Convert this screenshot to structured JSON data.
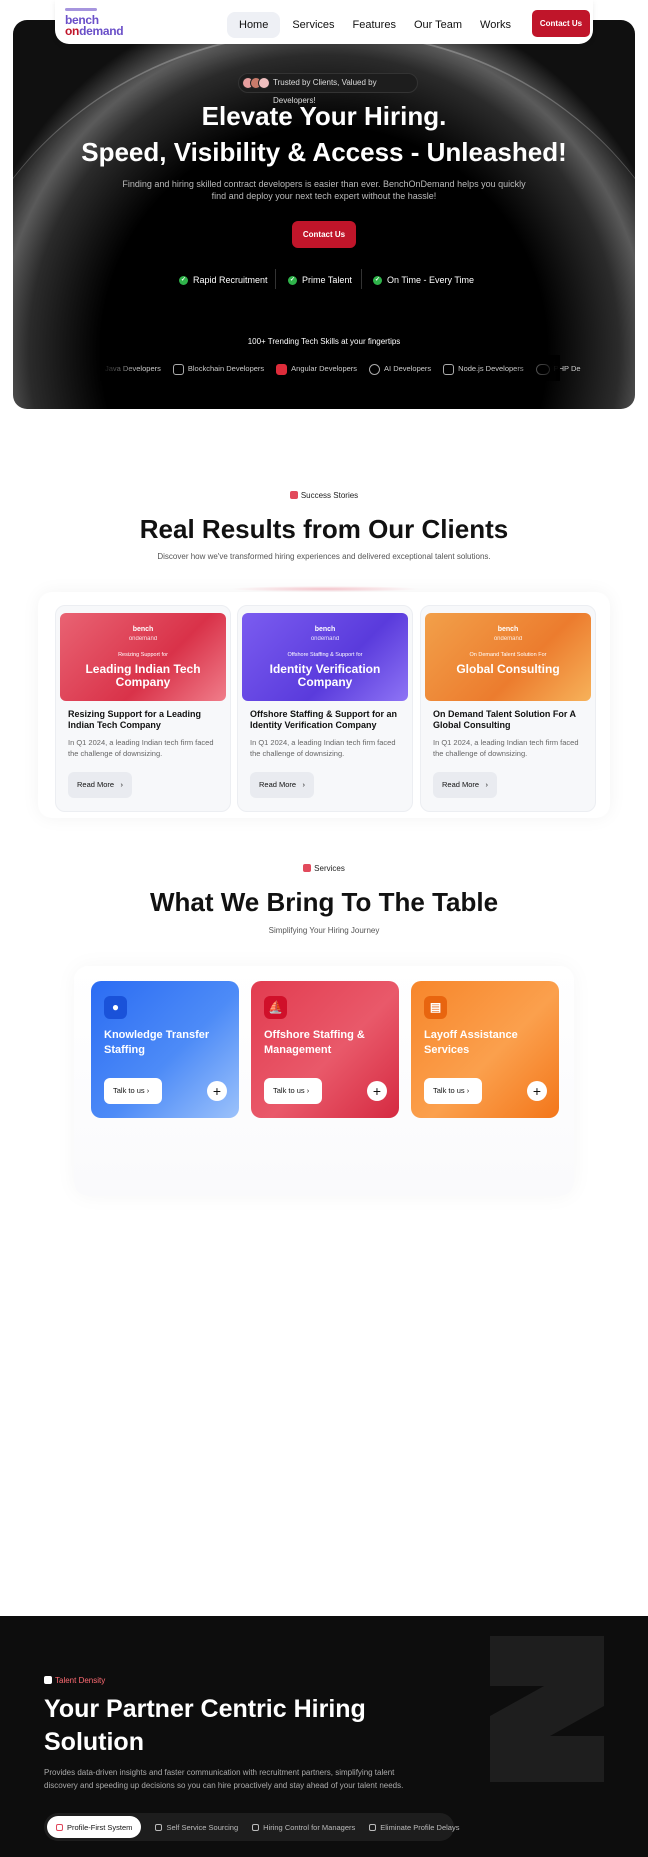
{
  "nav": {
    "logo": {
      "word1": "bench",
      "word2_accent": "on",
      "word2": "demand"
    },
    "items": [
      "Home",
      "Services",
      "Features",
      "Our Team",
      "Works"
    ],
    "active": "Home",
    "cta": "Contact Us"
  },
  "hero": {
    "badge": "Trusted by Clients, Valued by Developers!",
    "title_line1": "Elevate Your Hiring.",
    "title_line2": "Speed, Visibility & Access - Unleashed!",
    "subtitle": "Finding and hiring skilled contract developers is easier than ever. BenchOnDemand helps you quickly find and deploy your next tech expert without the hassle!",
    "cta": "Contact Us",
    "features": [
      "Rapid Recruitment",
      "Prime Talent",
      "On Time - Every Time"
    ],
    "trending_label": "100+ Trending Tech Skills at your fingertips",
    "skills": [
      "Java Developers",
      "Blockchain Developers",
      "Angular Developers",
      "AI Developers",
      "Node.js Developers",
      "PHP De"
    ]
  },
  "stories": {
    "tag": "Success Stories",
    "title": "Real Results from Our Clients",
    "subtitle": "Discover how we've transformed hiring experiences and delivered exceptional talent solutions.",
    "cards": [
      {
        "thumb_small": "Resizing Support for",
        "thumb_big": "Leading Indian Tech Company",
        "title": "Resizing Support for a Leading Indian Tech Company",
        "desc": "In Q1 2024, a leading Indian tech firm faced the challenge of downsizing.",
        "button": "Read More",
        "color": "#e0455a"
      },
      {
        "thumb_small": "Offshore Staffing & Support for",
        "thumb_big": "Identity Verification Company",
        "title": "Offshore Staffing & Support for an Identity Verification Company",
        "desc": "In Q1 2024, a leading Indian tech firm faced the challenge of downsizing.",
        "button": "Read More",
        "color": "#6a4de0"
      },
      {
        "thumb_small": "On Demand Talent Solution For",
        "thumb_big": "Global Consulting",
        "title": "On Demand Talent Solution For A Global Consulting",
        "desc": "In Q1 2024, a leading Indian tech firm faced the challenge of downsizing.",
        "button": "Read More",
        "color": "#ef8c3a"
      }
    ]
  },
  "services": {
    "tag": "Services",
    "title": "What We Bring To The Table",
    "subtitle": "Simplifying Your Hiring Journey",
    "cards": [
      {
        "title": "Knowledge Transfer Staffing",
        "button": "Talk to us",
        "icon": "globe-icon",
        "color": "#2f6df5"
      },
      {
        "title": "Offshore Staffing & Management",
        "button": "Talk to us",
        "icon": "ship-icon",
        "color": "#e03449"
      },
      {
        "title": "Layoff Assistance Services",
        "button": "Talk to us",
        "icon": "clipboard-icon",
        "color": "#f57a1f"
      }
    ]
  },
  "talent": {
    "tag": "Talent Density",
    "title": "Your Partner Centric Hiring Solution",
    "subtitle": "Provides data-driven insights and faster communication with recruitment partners, simplifying talent discovery and speeding up decisions so you can hire proactively and stay ahead of your talent needs.",
    "tabs": [
      "Profile-First System",
      "Self Service Sourcing",
      "Hiring Control for Managers",
      "Eliminate Profile Delays"
    ],
    "active_tab": "Profile-First System"
  }
}
